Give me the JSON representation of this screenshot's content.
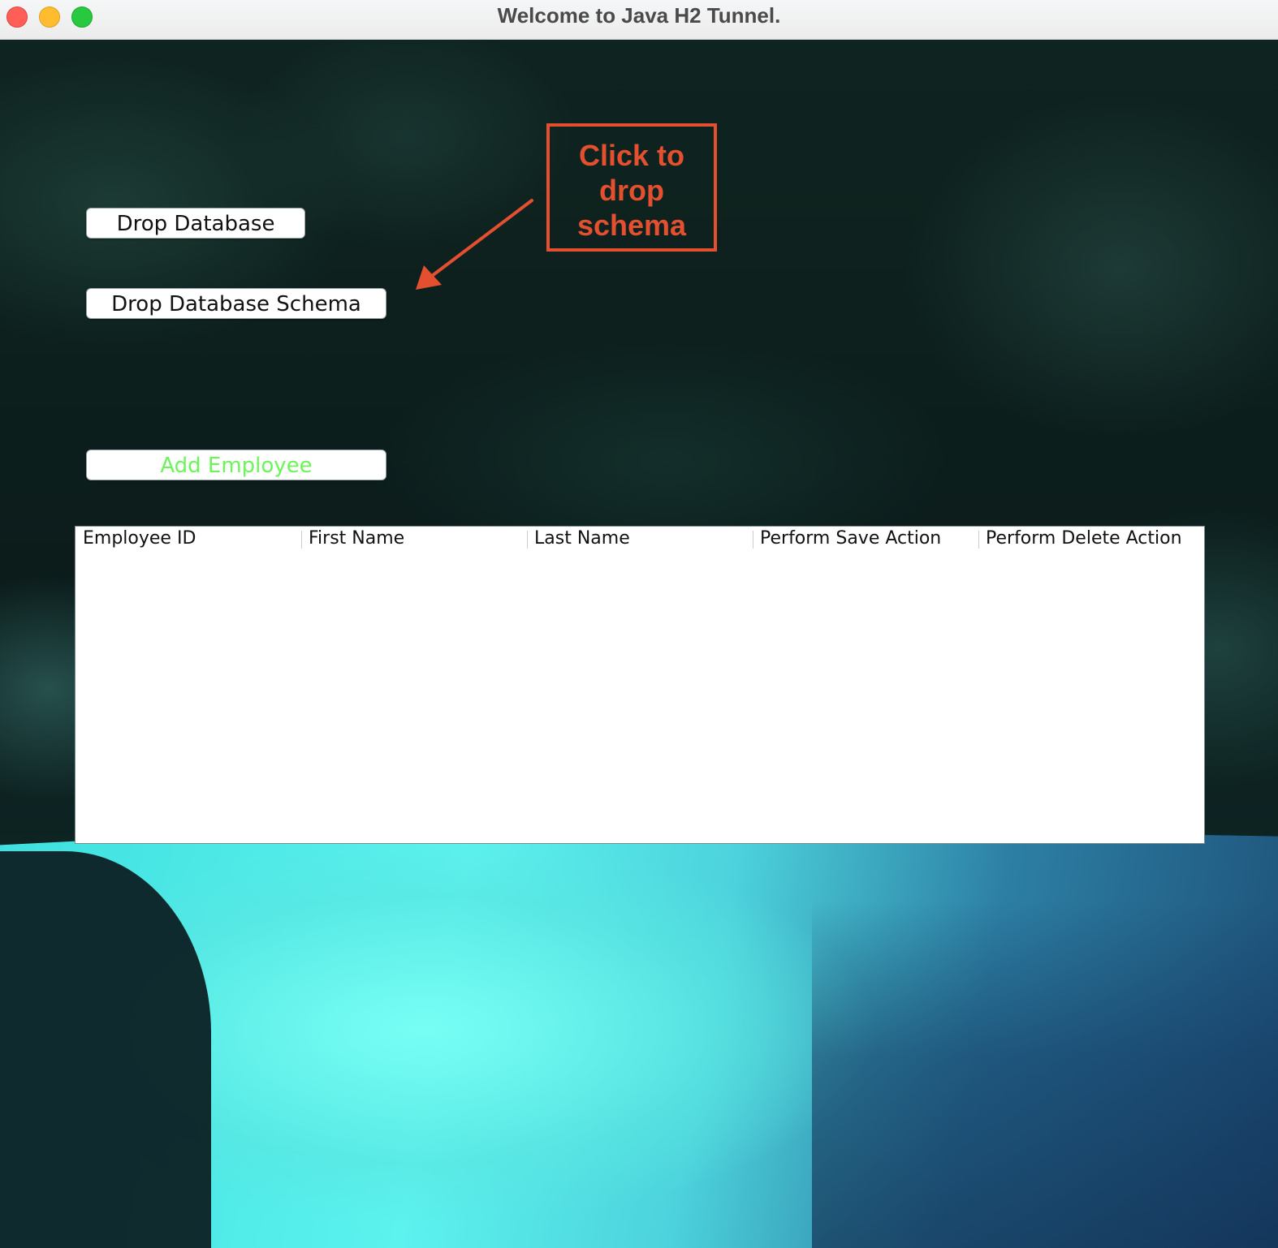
{
  "window": {
    "title": "Welcome to Java H2 Tunnel."
  },
  "buttons": {
    "drop_database": "Drop Database",
    "drop_database_schema": "Drop Database Schema",
    "add_employee": "Add Employee"
  },
  "annotation": {
    "line1": "Click to",
    "line2": "drop",
    "line3": "schema",
    "color": "#e4502f"
  },
  "table": {
    "columns": [
      "Employee ID",
      "First Name",
      "Last Name",
      "Perform Save Action",
      "Perform Delete Action"
    ],
    "rows": []
  },
  "colors": {
    "add_button_text": "#6cf55a",
    "close": "#ff5f57",
    "minimize": "#febc2e",
    "zoom": "#28c840"
  },
  "icons": {
    "arrow": "arrow-down-left-icon"
  }
}
